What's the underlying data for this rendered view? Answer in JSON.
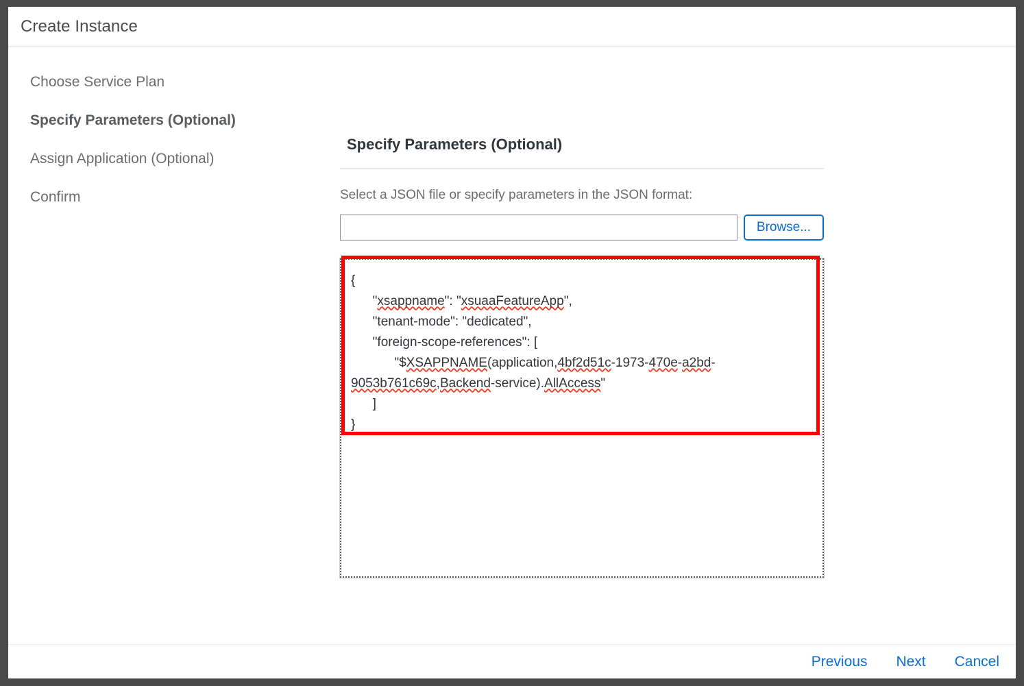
{
  "dialog": {
    "title": "Create Instance"
  },
  "wizard": {
    "steps": [
      {
        "label": "Choose Service Plan",
        "active": false
      },
      {
        "label": "Specify Parameters (Optional)",
        "active": true
      },
      {
        "label": "Assign Application (Optional)",
        "active": false
      },
      {
        "label": "Confirm",
        "active": false
      }
    ]
  },
  "panel": {
    "title": "Specify Parameters (Optional)",
    "instruction": "Select a JSON file or specify parameters in the JSON format:",
    "file_input": {
      "value": "",
      "placeholder": ""
    },
    "browse_label": "Browse...",
    "json_editor": {
      "lines": [
        {
          "indent": 0,
          "text": "{",
          "spell": []
        },
        {
          "indent": 1,
          "text": "\"xsappname\": \"xsuaaFeatureApp\",",
          "spell": [
            "xsappname",
            "xsuaaFeatureApp"
          ]
        },
        {
          "indent": 1,
          "text": "\"tenant-mode\": \"dedicated\",",
          "spell": []
        },
        {
          "indent": 1,
          "text": "\"foreign-scope-references\": [",
          "spell": []
        },
        {
          "indent": 2,
          "text": "\"$XSAPPNAME(application,4bf2d51c-1973-470e-a2bd-9053b761c69c,Backend-service).AllAccess\"",
          "spell": [
            "XSAPPNAME",
            "4bf2d51c",
            "470e",
            "a2bd",
            "9053b761c69c",
            "Backend",
            "AllAccess"
          ]
        },
        {
          "indent": 1,
          "text": "]",
          "spell": []
        },
        {
          "indent": 0,
          "text": "}",
          "spell": []
        }
      ],
      "full_text": "{\n    \"xsappname\": \"xsuaaFeatureApp\",\n    \"tenant-mode\": \"dedicated\",\n    \"foreign-scope-references\": [\n        \"$XSAPPNAME(application,4bf2d51c-1973-470e-a2bd-9053b761c69c,Backend-service).AllAccess\"\n    ]\n}"
    },
    "highlight_color": "#ff0000"
  },
  "footer": {
    "previous_label": "Previous",
    "next_label": "Next",
    "cancel_label": "Cancel"
  },
  "colors": {
    "accent": "#0a6ed1",
    "text": "#32363a",
    "muted": "#6a6d70",
    "backdrop": "#4a4a4a",
    "highlight": "#ff0000"
  }
}
